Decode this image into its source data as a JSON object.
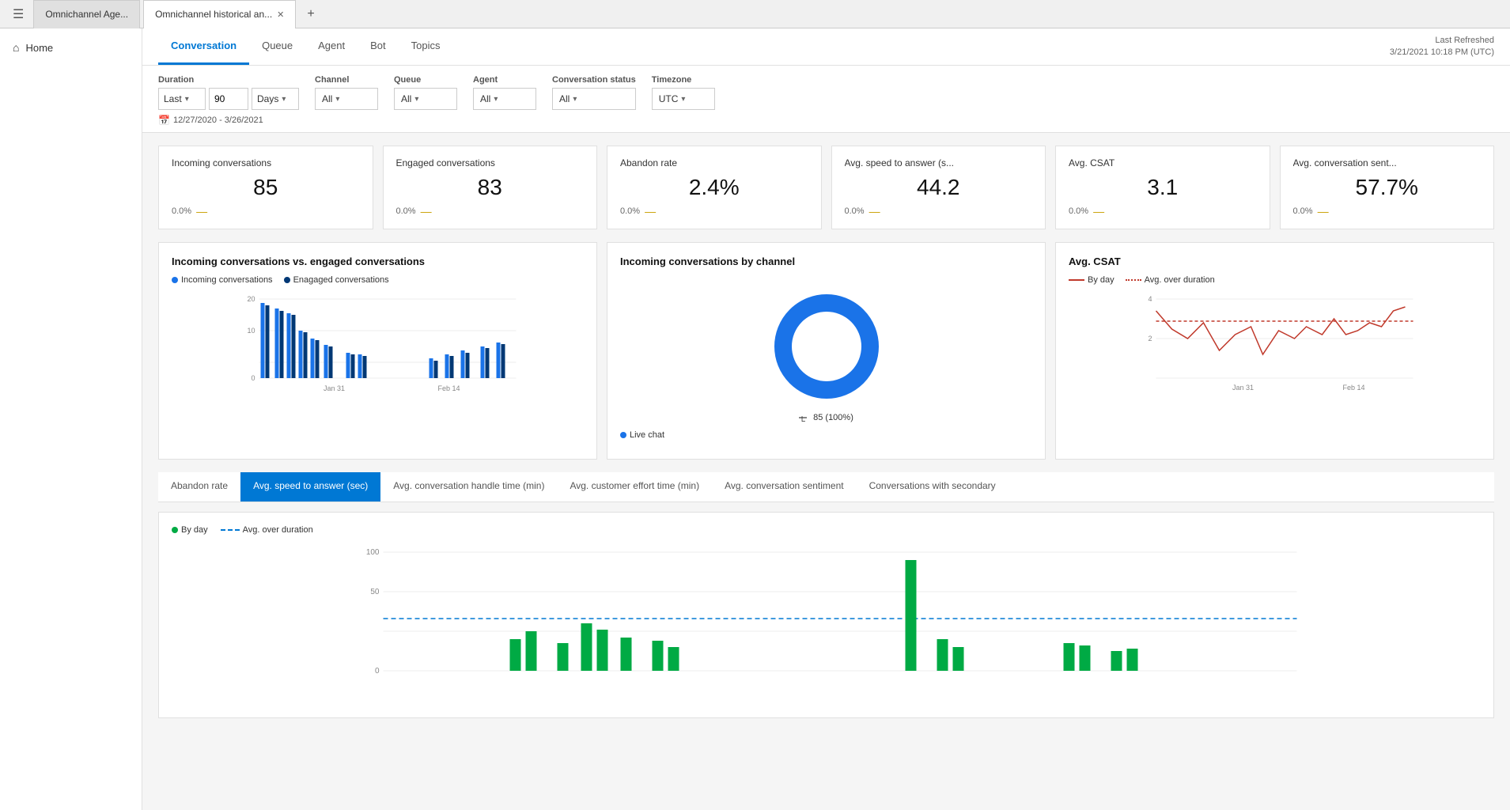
{
  "tabBar": {
    "hamburger": "☰",
    "tabs": [
      {
        "label": "Omnichannel Age...",
        "active": false,
        "closeable": false
      },
      {
        "label": "Omnichannel historical an...",
        "active": true,
        "closeable": true
      }
    ],
    "addTab": "+"
  },
  "sidebar": {
    "items": [
      {
        "label": "Home",
        "icon": "⌂"
      }
    ]
  },
  "topNav": {
    "tabs": [
      {
        "label": "Conversation",
        "active": true
      },
      {
        "label": "Queue",
        "active": false
      },
      {
        "label": "Agent",
        "active": false
      },
      {
        "label": "Bot",
        "active": false
      },
      {
        "label": "Topics",
        "active": false
      }
    ],
    "lastRefreshedLabel": "Last Refreshed",
    "lastRefreshedValue": "3/21/2021 10:18 PM (UTC)"
  },
  "filters": {
    "duration": {
      "label": "Duration",
      "preset": "Last",
      "value": "90",
      "unit": "Days"
    },
    "channel": {
      "label": "Channel",
      "value": "All"
    },
    "queue": {
      "label": "Queue",
      "value": "All"
    },
    "agent": {
      "label": "Agent",
      "value": "All"
    },
    "conversationStatus": {
      "label": "Conversation status",
      "value": "All"
    },
    "timezone": {
      "label": "Timezone",
      "value": "UTC"
    },
    "dateRange": "12/27/2020 - 3/26/2021"
  },
  "kpis": [
    {
      "title": "Incoming conversations",
      "value": "85",
      "change": "0.0%",
      "dash": "—"
    },
    {
      "title": "Engaged conversations",
      "value": "83",
      "change": "0.0%",
      "dash": "—"
    },
    {
      "title": "Abandon rate",
      "value": "2.4%",
      "change": "0.0%",
      "dash": "—"
    },
    {
      "title": "Avg. speed to answer (s...",
      "value": "44.2",
      "change": "0.0%",
      "dash": "—"
    },
    {
      "title": "Avg. CSAT",
      "value": "3.1",
      "change": "0.0%",
      "dash": "—"
    },
    {
      "title": "Avg. conversation sent...",
      "value": "57.7%",
      "change": "0.0%",
      "dash": "—"
    }
  ],
  "charts": {
    "barChart": {
      "title": "Incoming conversations vs. engaged conversations",
      "legend": [
        {
          "label": "Incoming conversations",
          "color": "#1a73e8"
        },
        {
          "label": "Enagaged conversations",
          "color": "#003875"
        }
      ],
      "yLabels": [
        "20",
        "10",
        "0"
      ],
      "xLabels": [
        "Jan 31",
        "Feb 14"
      ]
    },
    "donutChart": {
      "title": "Incoming conversations by channel",
      "legend": [
        {
          "label": "Live chat",
          "color": "#1a73e8"
        }
      ],
      "value": 85,
      "percent": "100%",
      "annotation": "85 (100%)"
    },
    "lineChart": {
      "title": "Avg. CSAT",
      "legend": [
        {
          "label": "By day",
          "color": "#c0392b",
          "style": "solid"
        },
        {
          "label": "Avg. over duration",
          "color": "#c0392b",
          "style": "dotted"
        }
      ],
      "yLabels": [
        "4",
        "2"
      ],
      "xLabels": [
        "Jan 31",
        "Feb 14"
      ]
    }
  },
  "bottomTabs": [
    {
      "label": "Abandon rate",
      "active": false
    },
    {
      "label": "Avg. speed to answer (sec)",
      "active": true
    },
    {
      "label": "Avg. conversation handle time (min)",
      "active": false
    },
    {
      "label": "Avg. customer effort time (min)",
      "active": false
    },
    {
      "label": "Avg. conversation sentiment",
      "active": false
    },
    {
      "label": "Conversations with secondary",
      "active": false
    }
  ],
  "bottomChart": {
    "legend": [
      {
        "label": "By day",
        "type": "dot",
        "color": "#00aa44"
      },
      {
        "label": "Avg. over duration",
        "type": "dashed",
        "color": "#0078d4"
      }
    ],
    "yLabels": [
      "100",
      "50",
      "0"
    ],
    "avgLine": 44
  }
}
